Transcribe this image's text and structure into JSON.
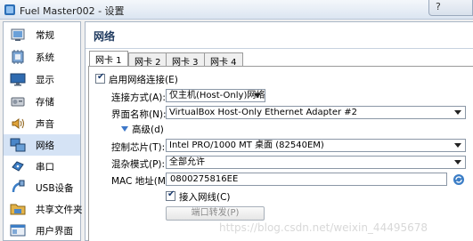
{
  "window": {
    "title": "Fuel Master002 - 设置",
    "help_label": "?"
  },
  "sidebar": {
    "items": [
      {
        "label": "常规",
        "icon": "general-icon"
      },
      {
        "label": "系统",
        "icon": "system-icon"
      },
      {
        "label": "显示",
        "icon": "display-icon"
      },
      {
        "label": "存储",
        "icon": "storage-icon"
      },
      {
        "label": "声音",
        "icon": "audio-icon"
      },
      {
        "label": "网络",
        "icon": "network-icon",
        "selected": true
      },
      {
        "label": "串口",
        "icon": "serial-port-icon"
      },
      {
        "label": "USB设备",
        "icon": "usb-icon"
      },
      {
        "label": "共享文件夹",
        "icon": "shared-folder-icon"
      },
      {
        "label": "用户界面",
        "icon": "user-interface-icon"
      }
    ]
  },
  "main": {
    "section_title": "网络",
    "tabs": [
      {
        "label": "网卡 1",
        "active": true
      },
      {
        "label": "网卡 2"
      },
      {
        "label": "网卡 3"
      },
      {
        "label": "网卡 4"
      }
    ],
    "enable_adapter": {
      "label": "启用网络连接(E)",
      "checked": true
    },
    "attached_to": {
      "label": "连接方式(A):",
      "value": "仅主机(Host-Only)网络"
    },
    "name": {
      "label": "界面名称(N):",
      "value": "VirtualBox Host-Only Ethernet Adapter #2"
    },
    "advanced": {
      "label": "高级(d)"
    },
    "adapter_type": {
      "label": "控制芯片(T):",
      "value": "Intel PRO/1000 MT 桌面 (82540EM)"
    },
    "promiscuous": {
      "label": "混杂模式(P):",
      "value": "全部允许"
    },
    "mac": {
      "label": "MAC 地址(M):",
      "value": "0800275816EE"
    },
    "cable": {
      "label": "接入网线(C)",
      "checked": true
    },
    "port_forward": {
      "label": "端口转发(P)"
    }
  },
  "watermark": "https://blog.csdn.net/weixin_44495678",
  "colors": {
    "accent": "#1f3a5f",
    "selection": "#d5e3f5",
    "panel_border": "#a9b6c6"
  }
}
